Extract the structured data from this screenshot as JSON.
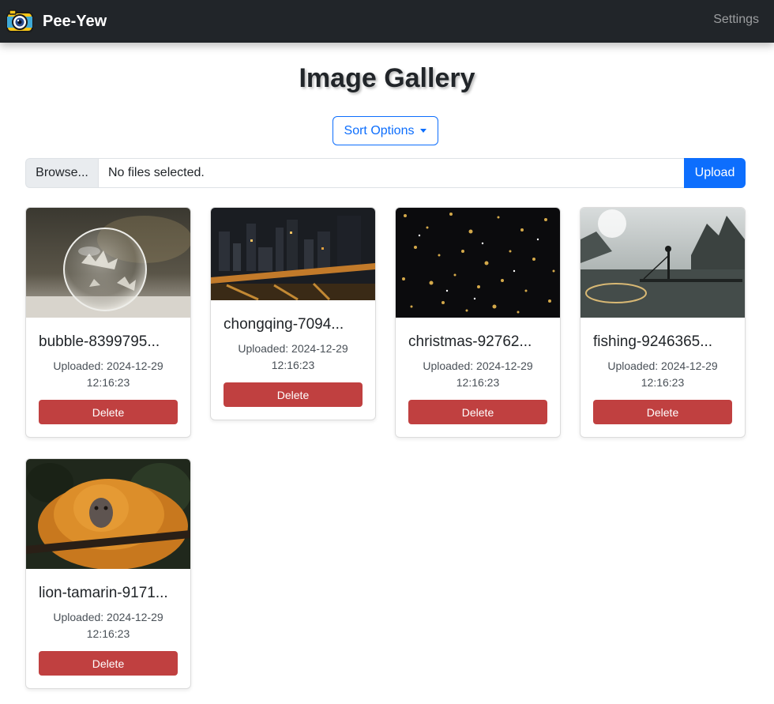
{
  "navbar": {
    "brand_name": "Pee-Yew",
    "settings_label": "Settings",
    "logo_icon": "camera-logo-icon"
  },
  "page": {
    "title": "Image Gallery",
    "sort_label": "Sort Options",
    "browse_label": "Browse...",
    "file_status": "No files selected.",
    "upload_label": "Upload"
  },
  "gallery": [
    {
      "name": "bubble-8399795...",
      "uploaded": "Uploaded: 2024-12-29 12:16:23",
      "delete_label": "Delete",
      "image": "frozen-bubble-photo"
    },
    {
      "name": "chongqing-7094...",
      "uploaded": "Uploaded: 2024-12-29 12:16:23",
      "delete_label": "Delete",
      "image": "city-night-bridge-photo"
    },
    {
      "name": "christmas-92762...",
      "uploaded": "Uploaded: 2024-12-29 12:16:23",
      "delete_label": "Delete",
      "image": "gold-stars-photo"
    },
    {
      "name": "fishing-9246365...",
      "uploaded": "Uploaded: 2024-12-29 12:16:23",
      "delete_label": "Delete",
      "image": "fisherman-river-photo"
    },
    {
      "name": "lion-tamarin-9171...",
      "uploaded": "Uploaded: 2024-12-29 12:16:23",
      "delete_label": "Delete",
      "image": "golden-lion-tamarin-photo"
    }
  ],
  "colors": {
    "navbar_bg": "#212529",
    "primary": "#0d6efd",
    "danger": "#c04040"
  }
}
